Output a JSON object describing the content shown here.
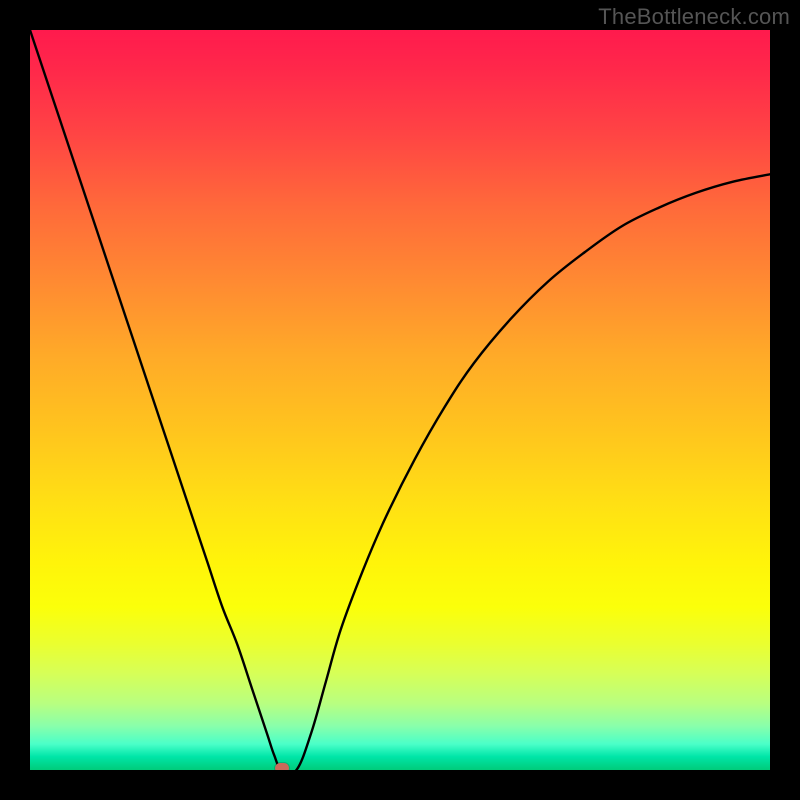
{
  "watermark": "TheBottleneck.com",
  "chart_data": {
    "type": "line",
    "title": "",
    "xlabel": "",
    "ylabel": "",
    "xlim": [
      0,
      100
    ],
    "ylim": [
      0,
      100
    ],
    "grid": false,
    "legend": false,
    "background": "rainbow-vertical-gradient",
    "series": [
      {
        "name": "bottleneck-curve",
        "x": [
          0,
          2,
          4,
          6,
          8,
          10,
          12,
          14,
          16,
          18,
          20,
          22,
          24,
          26,
          28,
          30,
          32,
          33,
          34,
          36,
          38,
          40,
          42,
          45,
          48,
          52,
          56,
          60,
          65,
          70,
          75,
          80,
          85,
          90,
          95,
          100
        ],
        "y": [
          100,
          94,
          88,
          82,
          76,
          70,
          64,
          58,
          52,
          46,
          40,
          34,
          28,
          22,
          17,
          11,
          5,
          2,
          0,
          0,
          5,
          12,
          19,
          27,
          34,
          42,
          49,
          55,
          61,
          66,
          70,
          73.5,
          76,
          78,
          79.5,
          80.5
        ]
      }
    ],
    "marker": {
      "x": 34,
      "y": 0,
      "color": "#c96a5a"
    }
  },
  "colors": {
    "frame": "#000000",
    "watermark": "#555555",
    "curve": "#000000",
    "marker": "#c96a5a"
  }
}
